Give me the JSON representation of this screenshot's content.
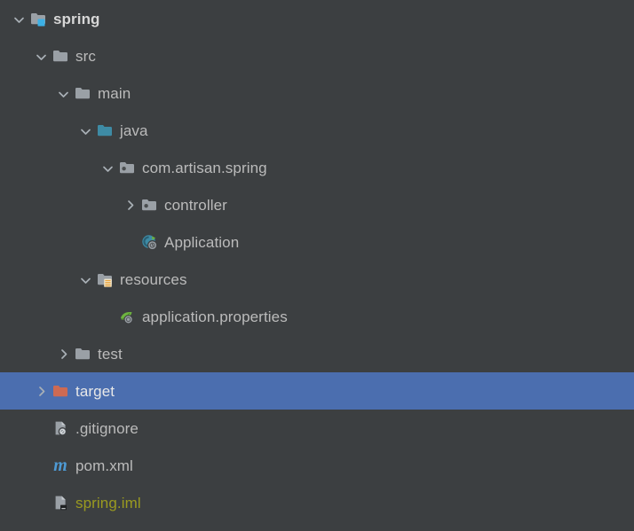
{
  "theme": {
    "background": "#3c3f41",
    "selection": "#4b6eaf",
    "text": "#bbbbbb",
    "text_bold": "#d7d7d7",
    "text_ignored": "#9a9a20",
    "folder_gray": "#9aa0a6",
    "folder_sources": "#3e8ba5",
    "folder_excluded": "#cd6a53",
    "maven_blue": "#4e9ad4",
    "spring_green": "#6db33f",
    "badge_cyan": "#3cb0e5",
    "badge_orange": "#e8a33d"
  },
  "tree": {
    "name": "project-tree",
    "nodes": [
      {
        "label": "spring",
        "depth": 0,
        "twisty": "chevron-down-icon",
        "icon": "folder-module-icon",
        "icon_name": "module-folder-icon",
        "selected": false,
        "bold": true,
        "ignored": false
      },
      {
        "label": "src",
        "depth": 1,
        "twisty": "chevron-down-icon",
        "icon": "folder-plain-icon",
        "icon_name": "folder-icon",
        "selected": false,
        "bold": false,
        "ignored": false
      },
      {
        "label": "main",
        "depth": 2,
        "twisty": "chevron-down-icon",
        "icon": "folder-plain-icon",
        "icon_name": "folder-icon",
        "selected": false,
        "bold": false,
        "ignored": false
      },
      {
        "label": "java",
        "depth": 3,
        "twisty": "chevron-down-icon",
        "icon": "folder-sources-icon",
        "icon_name": "sources-root-folder-icon",
        "selected": false,
        "bold": false,
        "ignored": false
      },
      {
        "label": "com.artisan.spring",
        "depth": 4,
        "twisty": "chevron-down-icon",
        "icon": "folder-package-icon",
        "icon_name": "java-package-icon",
        "selected": false,
        "bold": false,
        "ignored": false
      },
      {
        "label": "controller",
        "depth": 5,
        "twisty": "chevron-right-icon",
        "icon": "folder-package-icon",
        "icon_name": "java-package-icon",
        "selected": false,
        "bold": false,
        "ignored": false
      },
      {
        "label": "Application",
        "depth": 5,
        "twisty": "none",
        "icon": "spring-boot-class-icon",
        "icon_name": "spring-boot-application-class-icon",
        "selected": false,
        "bold": false,
        "ignored": false
      },
      {
        "label": "resources",
        "depth": 3,
        "twisty": "chevron-down-icon",
        "icon": "folder-resources-icon",
        "icon_name": "resources-root-folder-icon",
        "selected": false,
        "bold": false,
        "ignored": false
      },
      {
        "label": "application.properties",
        "depth": 4,
        "twisty": "none",
        "icon": "spring-properties-icon",
        "icon_name": "spring-properties-file-icon",
        "selected": false,
        "bold": false,
        "ignored": false
      },
      {
        "label": "test",
        "depth": 2,
        "twisty": "chevron-right-icon",
        "icon": "folder-plain-icon",
        "icon_name": "folder-icon",
        "selected": false,
        "bold": false,
        "ignored": false
      },
      {
        "label": "target",
        "depth": 1,
        "twisty": "chevron-right-icon",
        "icon": "folder-excluded-icon",
        "icon_name": "excluded-folder-icon",
        "selected": true,
        "bold": false,
        "ignored": false
      },
      {
        "label": ".gitignore",
        "depth": 1,
        "twisty": "none",
        "icon": "file-ignored-icon",
        "icon_name": "gitignore-file-icon",
        "selected": false,
        "bold": false,
        "ignored": false
      },
      {
        "label": "pom.xml",
        "depth": 1,
        "twisty": "none",
        "icon": "maven-icon",
        "icon_name": "maven-pom-icon",
        "selected": false,
        "bold": false,
        "ignored": false
      },
      {
        "label": "spring.iml",
        "depth": 1,
        "twisty": "none",
        "icon": "file-module-icon",
        "icon_name": "iml-module-file-icon",
        "selected": false,
        "bold": false,
        "ignored": true
      }
    ]
  }
}
